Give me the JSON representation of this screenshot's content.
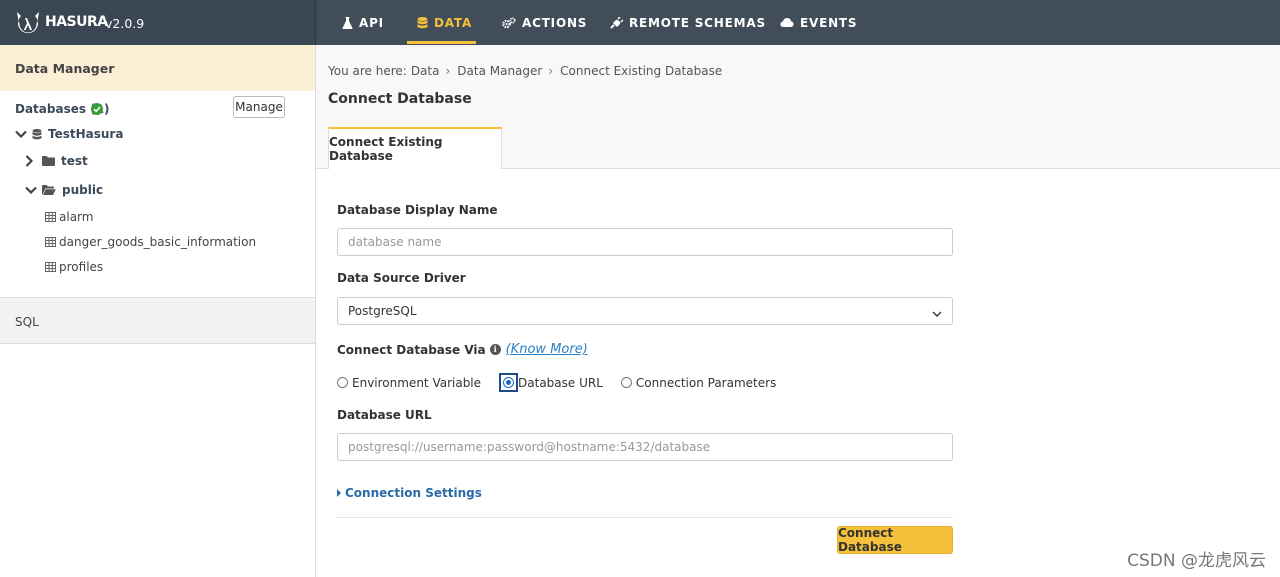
{
  "brand": {
    "name": "HASURA",
    "version": "v2.0.9"
  },
  "nav": [
    {
      "label": "API",
      "icon": "flask-icon"
    },
    {
      "label": "DATA",
      "icon": "database-icon",
      "active": true
    },
    {
      "label": "ACTIONS",
      "icon": "cogs-icon"
    },
    {
      "label": "REMOTE SCHEMAS",
      "icon": "plug-icon"
    },
    {
      "label": "EVENTS",
      "icon": "cloud-icon"
    }
  ],
  "sidebar": {
    "header": "Data Manager",
    "databases_label": "Databases (1)",
    "manage_label": "Manage",
    "database": "TestHasura",
    "schemas": [
      {
        "name": "test",
        "expanded": false
      },
      {
        "name": "public",
        "expanded": true
      }
    ],
    "tables": [
      "alarm",
      "danger_goods_basic_information",
      "profiles"
    ],
    "sql_label": "SQL"
  },
  "breadcrumb": {
    "prefix": "You are here:",
    "items": [
      "Data",
      "Data Manager",
      "Connect Existing Database"
    ]
  },
  "page_title": "Connect Database",
  "tab_label": "Connect Existing Database",
  "form": {
    "display_name_label": "Database Display Name",
    "display_name_placeholder": "database name",
    "driver_label": "Data Source Driver",
    "driver_value": "PostgreSQL",
    "connect_via_label": "Connect Database Via",
    "know_more": "(Know More)",
    "options": [
      "Environment Variable",
      "Database URL",
      "Connection Parameters"
    ],
    "selected_option": "Database URL",
    "url_label": "Database URL",
    "url_placeholder": "postgresql://username:password@hostname:5432/database",
    "connection_settings": "Connection Settings",
    "submit": "Connect Database"
  },
  "watermark": "CSDN @龙虎风云",
  "colors": {
    "accent": "#f6c13a",
    "topbar": "#414d58",
    "link": "#2b7ec1"
  }
}
